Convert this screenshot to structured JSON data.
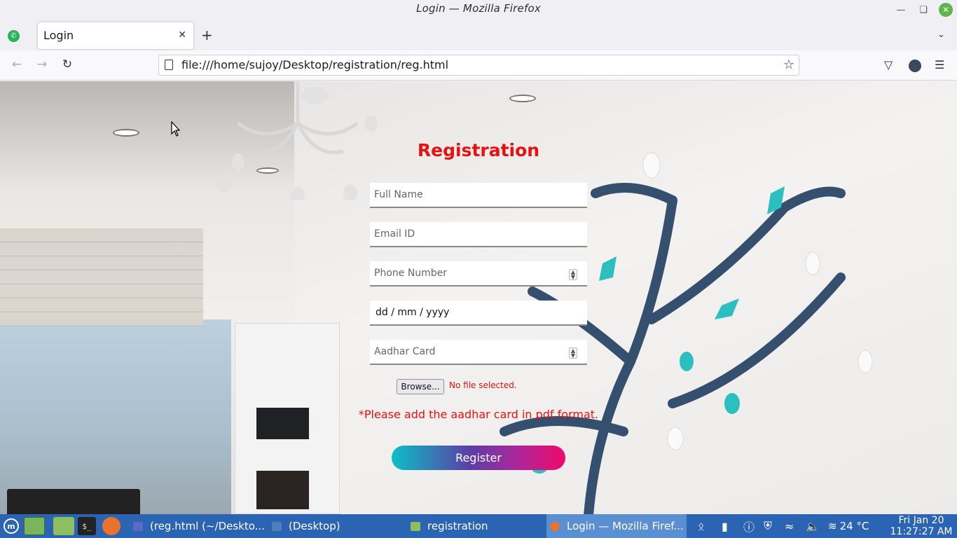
{
  "window": {
    "title": "Login — Mozilla Firefox"
  },
  "tabs": [
    {
      "label": "Login"
    }
  ],
  "navbar": {
    "url": "file:///home/sujoy/Desktop/registration/reg.html"
  },
  "form": {
    "title": "Registration",
    "full_name_placeholder": "Full Name",
    "email_placeholder": "Email ID",
    "phone_placeholder": "Phone Number",
    "dob_value": "dd / mm / yyyy",
    "aadhar_placeholder": "Aadhar Card",
    "browse_label": "Browse...",
    "file_status": "No file selected.",
    "aadhar_note": "*Please add the aadhar card in pdf format.",
    "register_label": "Register",
    "accent_color": "#e81010"
  },
  "taskbar": {
    "tasks": [
      {
        "label": "(reg.html (~/Deskto..."
      },
      {
        "label": "(Desktop)"
      },
      {
        "label": "registration"
      },
      {
        "label": "Login — Mozilla Firef..."
      }
    ],
    "weather": "24 °C",
    "clock_date": "Fri Jan 20",
    "clock_time": "11:27:27 AM"
  }
}
